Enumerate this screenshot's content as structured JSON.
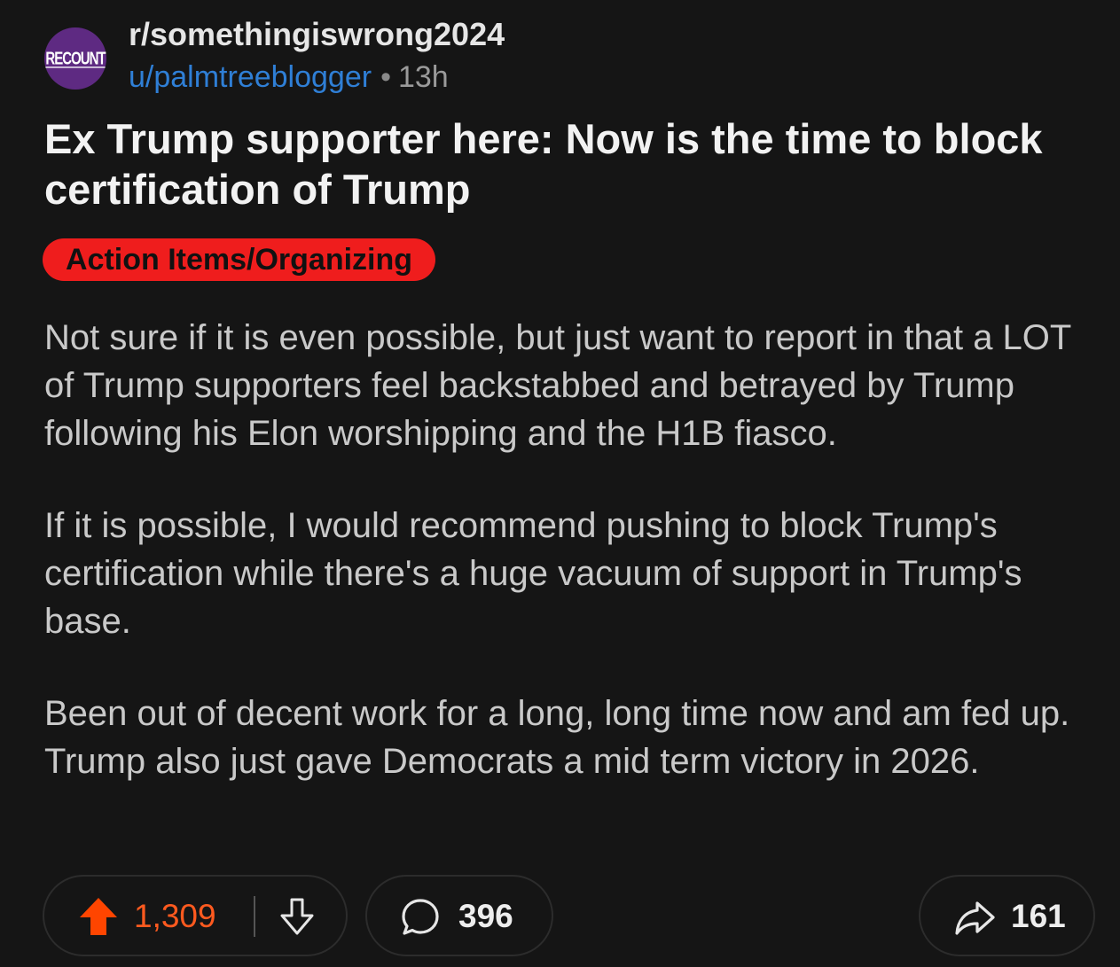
{
  "post": {
    "avatar_text": "RECOUNT",
    "subreddit": "r/somethingiswrong2024",
    "username": "u/palmtreeblogger",
    "separator": "•",
    "time": "13h",
    "title": "Ex Trump supporter here: Now is the time to block certification of Trump",
    "flair": "Action Items/Organizing",
    "paragraphs": [
      "Not sure if it is even possible, but just want to report in that a LOT of Trump supporters feel backstabbed and betrayed by Trump following his Elon worshipping and the H1B fiasco.",
      "If it is possible, I would recommend pushing to block Trump's certification while there's a huge vacuum of support in Trump's base.",
      "Been out of decent work for a long, long time now and am fed up.  Trump also just gave Democrats a mid term victory in 2026."
    ]
  },
  "actions": {
    "upvotes": "1,309",
    "comments": "396",
    "shares": "161"
  },
  "icons": {
    "upvote": "upvote-arrow-icon",
    "downvote": "downvote-arrow-icon",
    "comment": "comment-bubble-icon",
    "share": "share-arrow-icon"
  },
  "colors": {
    "background": "#151515",
    "upvote_active": "#ff4500",
    "vote_count": "#ff5a1f",
    "flair_bg": "#ef1d1d",
    "username": "#2f7fd6",
    "avatar_bg": "#5e2a82"
  }
}
